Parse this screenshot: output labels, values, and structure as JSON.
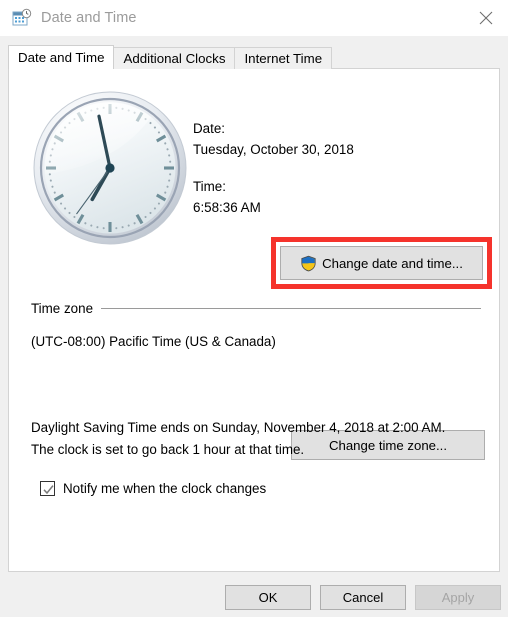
{
  "window": {
    "title": "Date and Time",
    "icon": "date-time-icon",
    "close_label": "×"
  },
  "tabs": [
    {
      "label": "Date and Time",
      "active": true
    },
    {
      "label": "Additional Clocks",
      "active": false
    },
    {
      "label": "Internet Time",
      "active": false
    }
  ],
  "main": {
    "clock": {
      "name": "analog-clock",
      "hour": 6,
      "minute": 58,
      "second": 36
    },
    "date_label": "Date:",
    "date_value": "Tuesday, October 30, 2018",
    "time_label": "Time:",
    "time_value": "6:58:36 AM",
    "change_date_time_button": "Change date and time...",
    "shield_icon": "uac-shield-icon"
  },
  "time_zone": {
    "legend": "Time zone",
    "value": "(UTC-08:00) Pacific Time (US & Canada)",
    "change_button": "Change time zone..."
  },
  "dst": {
    "text": "Daylight Saving Time ends on Sunday, November 4, 2018 at 2:00 AM. The clock is set to go back 1 hour at that time.",
    "checkbox_label": "Notify me when the clock changes",
    "checkbox_checked": true
  },
  "footer": {
    "ok": "OK",
    "cancel": "Cancel",
    "apply": "Apply",
    "apply_disabled": true
  },
  "annotation": {
    "highlight_color": "#f5332c",
    "target": "change-date-and-time-button"
  }
}
